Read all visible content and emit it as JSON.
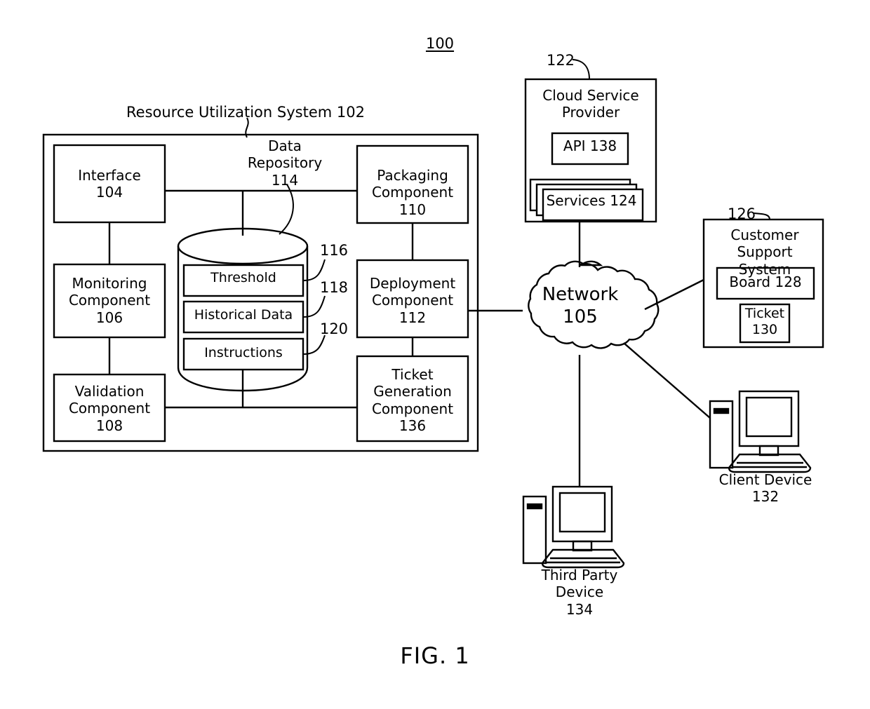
{
  "figure": {
    "number": "100",
    "caption": "FIG. 1"
  },
  "system": {
    "title": "Resource Utilization System  102",
    "components": {
      "interface": "Interface\n104",
      "monitoring": "Monitoring\nComponent 106",
      "validation": "Validation\nComponent 108",
      "packaging": "Packaging\nComponent 110",
      "deployment": "Deployment\nComponent 112",
      "ticket_generation": "Ticket\nGeneration\nComponent\n136"
    },
    "repository": {
      "label": "Data\nRepository\n114",
      "items": [
        {
          "label": "Threshold",
          "ref": "116"
        },
        {
          "label": "Historical Data",
          "ref": "118"
        },
        {
          "label": "Instructions",
          "ref": "120"
        }
      ]
    }
  },
  "cloud_service_provider": {
    "ref": "122",
    "title": "Cloud Service\nProvider",
    "api": "API 138",
    "services": "Services  124"
  },
  "network": {
    "label": "Network\n105"
  },
  "customer_support_system": {
    "ref": "126",
    "title": "Customer Support\nSystem",
    "board": "Board 128",
    "ticket": "Ticket\n130"
  },
  "devices": {
    "client": "Client Device\n132",
    "third_party": "Third Party Device\n134"
  },
  "colors": {
    "stroke": "#000000",
    "background": "#ffffff"
  }
}
